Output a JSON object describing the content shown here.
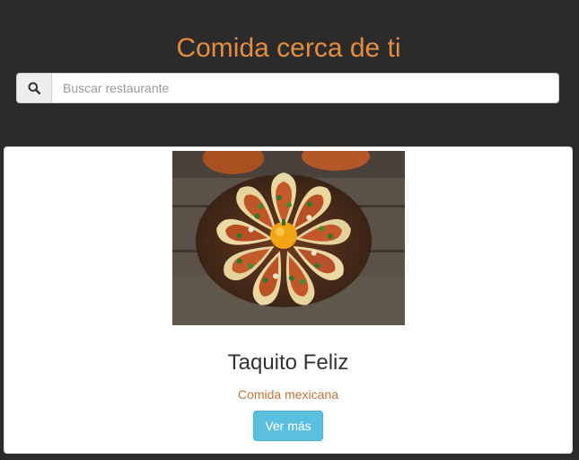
{
  "header": {
    "title": "Comida cerca de ti"
  },
  "search": {
    "icon": "search-icon",
    "placeholder": "Buscar restaurante",
    "value": ""
  },
  "restaurants": [
    {
      "name": "Taquito Feliz",
      "category": "Comida mexicana",
      "button_label": "Ver más",
      "image": "tacos-platter-photo"
    }
  ],
  "colors": {
    "background": "#2b2b2b",
    "title": "#e38d3e",
    "category": "#c0733a",
    "button": "#5bc0de"
  }
}
